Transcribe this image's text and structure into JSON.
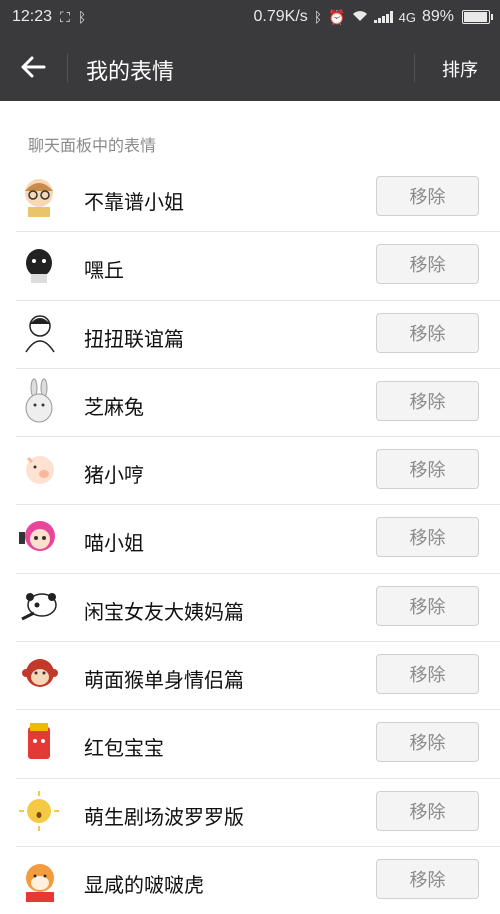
{
  "status_bar": {
    "time": "12:23",
    "network_speed": "0.79K/s",
    "network_type": "4G",
    "battery_text": "89%",
    "battery_level": 0.89
  },
  "header": {
    "title": "我的表情",
    "sort_label": "排序",
    "background_color": "#3a3a3c"
  },
  "section": {
    "label": "聊天面板中的表情"
  },
  "stickers": [
    {
      "name": "不靠谱小姐",
      "icon": "glasses-girl-sticker"
    },
    {
      "name": "嘿丘",
      "icon": "black-ghost-sticker"
    },
    {
      "name": "扭扭联谊篇",
      "icon": "sketch-girl-sticker"
    },
    {
      "name": "芝麻兔",
      "icon": "grey-rabbit-sticker"
    },
    {
      "name": "猪小哼",
      "icon": "pig-sticker"
    },
    {
      "name": "喵小姐",
      "icon": "pink-hair-girl-sticker"
    },
    {
      "name": "闲宝女友大姨妈篇",
      "icon": "panda-sticker"
    },
    {
      "name": "萌面猴单身情侣篇",
      "icon": "monkey-sticker"
    },
    {
      "name": "红包宝宝",
      "icon": "red-envelope-sticker"
    },
    {
      "name": "萌生剧场波罗罗版",
      "icon": "sun-face-sticker"
    },
    {
      "name": "显咸的啵啵虎",
      "icon": "tiger-sticker"
    }
  ],
  "remove_label": "移除"
}
